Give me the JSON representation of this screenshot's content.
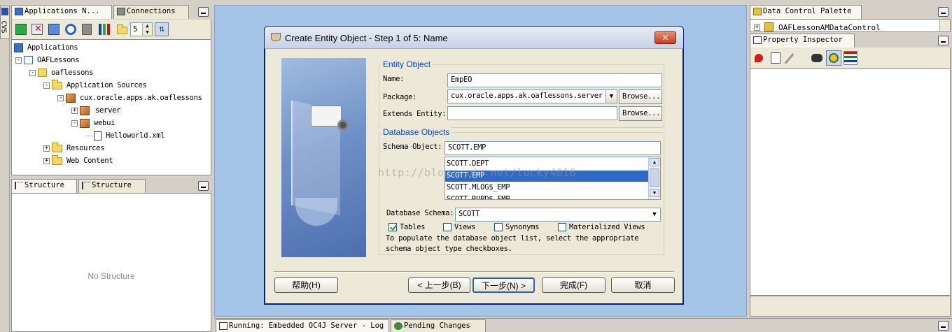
{
  "side_label": "CVS",
  "left_top": {
    "tabs": [
      "Applications N...",
      "Connections"
    ],
    "toolbar_count": "5",
    "tree": [
      {
        "label": "Applications",
        "depth": 0,
        "icon": "applications-icon",
        "expander": ""
      },
      {
        "label": "OAFLessons",
        "depth": 1,
        "icon": "workspace-icon",
        "expander": "-"
      },
      {
        "label": "oaflessons",
        "depth": 2,
        "icon": "project-icon",
        "expander": "-"
      },
      {
        "label": "Application Sources",
        "depth": 3,
        "icon": "folder-icon",
        "expander": "-"
      },
      {
        "label": "cux.oracle.apps.ak.oaflessons",
        "depth": 4,
        "icon": "package-icon",
        "expander": "-"
      },
      {
        "label": "server",
        "depth": 5,
        "icon": "package-icon",
        "expander": "+"
      },
      {
        "label": "webui",
        "depth": 5,
        "icon": "package-icon",
        "expander": "-"
      },
      {
        "label": "Helloworld.xml",
        "depth": 6,
        "icon": "xml-file-icon",
        "expander": ""
      },
      {
        "label": "Resources",
        "depth": 3,
        "icon": "folder-icon",
        "expander": "+"
      },
      {
        "label": "Web Content",
        "depth": 3,
        "icon": "folder-icon",
        "expander": "+"
      }
    ]
  },
  "structure": {
    "tabs": [
      "Structure",
      "Structure"
    ],
    "empty_text": "No Structure"
  },
  "bottom_tabs": [
    "Running: Embedded OC4J Server - Log",
    "Pending Changes"
  ],
  "right": {
    "palette_tab": "Data Control Palette",
    "palette_item": "OAFLessonAMDataControl",
    "inspector_tab": "Property Inspector"
  },
  "dialog": {
    "title": "Create Entity Object - Step 1 of 5: Name",
    "entity_group": "Entity Object",
    "name_label": "Name:",
    "name_value": "EmpEO",
    "package_label": "Package:",
    "package_value": "cux.oracle.apps.ak.oaflessons.server",
    "browse1": "Browse...",
    "extends_label": "Extends Entity:",
    "extends_value": "",
    "browse2": "Browse...",
    "db_group": "Database Objects",
    "schema_object_label": "Schema Object:",
    "schema_object_value": "SCOTT.EMP",
    "list_items": [
      "SCOTT.DEPT",
      "SCOTT.EMP",
      "SCOTT.MLOG$_EMP",
      "SCOTT.RUPD$_EMP"
    ],
    "selected_index": 1,
    "watermark": "http://blog.csdn.net/lucky4016",
    "db_schema_label": "Database Schema:",
    "db_schema_value": "SCOTT",
    "checkboxes": [
      {
        "label": "Tables",
        "checked": true
      },
      {
        "label": "Views",
        "checked": false
      },
      {
        "label": "Synonyms",
        "checked": false
      },
      {
        "label": "Materialized Views",
        "checked": false
      }
    ],
    "hint_line1": "To populate the database object list, select the appropriate",
    "hint_line2": "schema object type checkboxes.",
    "help_btn": "帮助(H)",
    "back_btn": "< 上一步(B)",
    "next_btn": "下一步(N) >",
    "finish_btn": "完成(F)",
    "cancel_btn": "取消"
  }
}
